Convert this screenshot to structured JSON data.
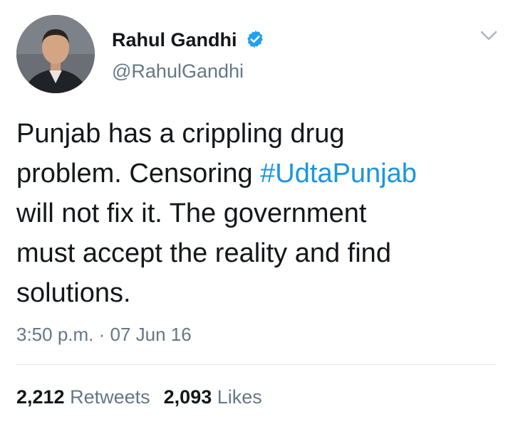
{
  "author": {
    "name": "Rahul Gandhi",
    "handle": "@RahulGandhi",
    "verified": true
  },
  "tweet": {
    "lines": [
      [
        "Punjab has a crippling drug"
      ],
      [
        "problem. Censoring ",
        "#UdtaPunjab"
      ],
      [
        "will not fix it. The government"
      ],
      [
        "must accept the reality and find"
      ],
      [
        "solutions."
      ]
    ],
    "line1": "Punjab has a crippling drug",
    "line2_pre": "problem. Censoring ",
    "hashtag": "#UdtaPunjab",
    "line3": "will not fix it. The government",
    "line4": "must accept the reality and find",
    "line5": "solutions."
  },
  "timestamp": "3:50 p.m. · 07 Jun 16",
  "stats": {
    "retweets_count": "2,212",
    "retweets_label": "Retweets",
    "likes_count": "2,093",
    "likes_label": "Likes"
  },
  "icons": {
    "verified": "verified-badge-icon",
    "menu": "chevron-down-icon"
  },
  "colors": {
    "link": "#1b95e0",
    "verified": "#1da1f2",
    "secondary_text": "#657786",
    "primary_text": "#14171a"
  }
}
